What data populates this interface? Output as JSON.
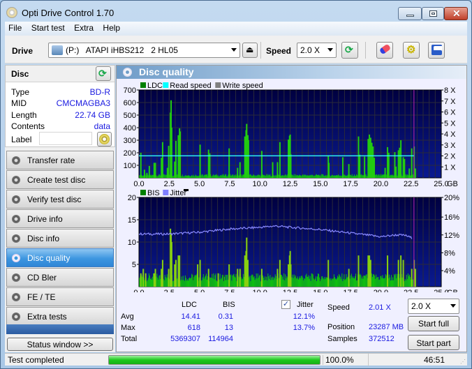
{
  "window": {
    "title": "Opti Drive Control 1.70"
  },
  "menu": [
    "File",
    "Start test",
    "Extra",
    "Help"
  ],
  "toolbar": {
    "drive_label": "Drive",
    "drive_value": "(P:)   ATAPI iHBS212   2 HL05",
    "speed_label": "Speed",
    "speed_value": "2.0 X"
  },
  "disc": {
    "title": "Disc",
    "fields": [
      {
        "key": "Type",
        "value": "BD-R"
      },
      {
        "key": "MID",
        "value": "CMCMAGBA3"
      },
      {
        "key": "Length",
        "value": "22.74 GB"
      },
      {
        "key": "Contents",
        "value": "data"
      }
    ],
    "label_key": "Label",
    "label_value": ""
  },
  "nav": [
    {
      "label": "Transfer rate",
      "active": false
    },
    {
      "label": "Create test disc",
      "active": false
    },
    {
      "label": "Verify test disc",
      "active": false
    },
    {
      "label": "Drive info",
      "active": false
    },
    {
      "label": "Disc info",
      "active": false
    },
    {
      "label": "Disc quality",
      "active": true
    },
    {
      "label": "CD Bler",
      "active": false
    },
    {
      "label": "FE / TE",
      "active": false
    },
    {
      "label": "Extra tests",
      "active": false
    }
  ],
  "status_window_label": "Status window >>",
  "panel_title": "Disc quality",
  "chart_data": [
    {
      "type": "bar",
      "title": "LDC",
      "legend": [
        {
          "name": "LDC",
          "color": "#008000"
        },
        {
          "name": "Read speed",
          "color": "#00ffff"
        },
        {
          "name": "Write speed",
          "color": "#808080"
        }
      ],
      "xlabel": "GB",
      "xlim": [
        0,
        25
      ],
      "x_ticks": [
        "0.0",
        "2.5",
        "5.0",
        "7.5",
        "10.0",
        "12.5",
        "15.0",
        "17.5",
        "20.0",
        "22.5",
        "25.0"
      ],
      "ylim": [
        0,
        700
      ],
      "y_ticks": [
        "100",
        "200",
        "300",
        "400",
        "500",
        "600",
        "700"
      ],
      "y2_ticks": [
        "1 X",
        "2 X",
        "3 X",
        "4 X",
        "5 X",
        "6 X",
        "7 X",
        "8 X"
      ],
      "y2lim": [
        0,
        8
      ],
      "baseline": 20,
      "peaks": [
        [
          0.1,
          200
        ],
        [
          0.4,
          65
        ],
        [
          0.6,
          40
        ],
        [
          0.8,
          95
        ],
        [
          1.2,
          120
        ],
        [
          1.3,
          120
        ],
        [
          1.8,
          160
        ],
        [
          1.9,
          285
        ],
        [
          2.3,
          80
        ],
        [
          2.4,
          255
        ],
        [
          2.55,
          520
        ],
        [
          2.6,
          618
        ],
        [
          2.65,
          400
        ],
        [
          2.9,
          130
        ],
        [
          3.0,
          295
        ],
        [
          3.2,
          340
        ],
        [
          3.3,
          395
        ],
        [
          3.35,
          370
        ],
        [
          5.0,
          265
        ],
        [
          5.7,
          225
        ],
        [
          5.8,
          195
        ],
        [
          7.4,
          235
        ],
        [
          8.1,
          80
        ],
        [
          8.3,
          125
        ],
        [
          8.7,
          330
        ],
        [
          8.8,
          380
        ],
        [
          8.85,
          430
        ],
        [
          8.95,
          340
        ],
        [
          9.0,
          300
        ],
        [
          10.1,
          215
        ],
        [
          11.0,
          125
        ],
        [
          11.4,
          125
        ],
        [
          11.6,
          285
        ],
        [
          12.3,
          305
        ],
        [
          12.4,
          335
        ],
        [
          12.45,
          345
        ],
        [
          12.5,
          190
        ],
        [
          15.6,
          180
        ],
        [
          15.65,
          120
        ],
        [
          16.8,
          165
        ],
        [
          17.3,
          110
        ],
        [
          18.1,
          330
        ],
        [
          18.2,
          185
        ],
        [
          18.6,
          170
        ],
        [
          18.9,
          310
        ],
        [
          19.0,
          345
        ],
        [
          19.1,
          320
        ],
        [
          19.2,
          280
        ],
        [
          19.3,
          250
        ],
        [
          19.4,
          160
        ],
        [
          20.3,
          80
        ],
        [
          20.5,
          245
        ],
        [
          20.6,
          200
        ],
        [
          21.1,
          205
        ],
        [
          21.2,
          90
        ],
        [
          21.4,
          220
        ],
        [
          21.5,
          240
        ],
        [
          21.6,
          300
        ],
        [
          21.8,
          165
        ],
        [
          21.9,
          150
        ],
        [
          22.3,
          75
        ],
        [
          22.5,
          235
        ],
        [
          22.7,
          250
        ],
        [
          22.8,
          75
        ]
      ],
      "read_speed_x": 2.01,
      "read_speed_range": [
        0,
        22.74
      ],
      "end_marker": 22.74
    },
    {
      "type": "bar",
      "title": "BIS / Jitter",
      "legend": [
        {
          "name": "BIS",
          "color": "#008000"
        },
        {
          "name": "Jitter",
          "color": "#8080ff"
        }
      ],
      "xlabel": "GB",
      "xlim": [
        0,
        25
      ],
      "x_ticks": [
        "0.0",
        "2.5",
        "5.0",
        "7.5",
        "10.0",
        "12.5",
        "15.0",
        "17.5",
        "20.0",
        "22.5",
        "25.0"
      ],
      "ylim": [
        0,
        20
      ],
      "y_ticks": [
        "5",
        "10",
        "15",
        "20"
      ],
      "y2lim": [
        0,
        20
      ],
      "y2_ticks": [
        "4%",
        "8%",
        "12%",
        "16%",
        "20%"
      ],
      "baseline": 2,
      "peaks": [
        [
          0.1,
          3
        ],
        [
          0.3,
          4
        ],
        [
          0.5,
          3
        ],
        [
          1.2,
          3
        ],
        [
          1.3,
          4
        ],
        [
          1.8,
          4
        ],
        [
          1.9,
          6
        ],
        [
          2.4,
          4
        ],
        [
          2.55,
          13
        ],
        [
          2.6,
          12
        ],
        [
          2.65,
          10
        ],
        [
          2.9,
          5
        ],
        [
          3.0,
          6
        ],
        [
          3.2,
          7
        ],
        [
          3.3,
          7
        ],
        [
          4.8,
          5
        ],
        [
          5.0,
          6
        ],
        [
          5.7,
          4
        ],
        [
          6.5,
          3
        ],
        [
          7.4,
          5
        ],
        [
          8.1,
          4
        ],
        [
          8.3,
          4
        ],
        [
          8.7,
          7
        ],
        [
          8.8,
          8
        ],
        [
          8.85,
          11
        ],
        [
          8.95,
          6
        ],
        [
          10.1,
          4
        ],
        [
          11.4,
          4
        ],
        [
          11.6,
          6
        ],
        [
          12.3,
          5
        ],
        [
          12.4,
          7
        ],
        [
          12.45,
          8
        ],
        [
          12.5,
          5
        ],
        [
          15.6,
          6
        ],
        [
          17.3,
          4
        ],
        [
          18.1,
          7
        ],
        [
          18.9,
          7
        ],
        [
          19.0,
          7
        ],
        [
          19.1,
          6
        ],
        [
          20.5,
          7
        ],
        [
          21.4,
          6
        ],
        [
          21.6,
          7
        ],
        [
          21.8,
          6
        ],
        [
          22.5,
          4
        ],
        [
          22.7,
          6
        ],
        [
          22.8,
          4
        ]
      ],
      "jitter": [
        [
          0,
          11.8
        ],
        [
          2.5,
          11.8
        ],
        [
          5.0,
          12.2
        ],
        [
          7.5,
          12.9
        ],
        [
          10.0,
          13.3
        ],
        [
          11.3,
          13.6
        ],
        [
          12.5,
          13.3
        ],
        [
          15.0,
          12.8
        ],
        [
          17.5,
          12.0
        ],
        [
          20.0,
          11.2
        ],
        [
          21.3,
          11.6
        ],
        [
          22.0,
          11.5
        ],
        [
          22.6,
          10.9
        ]
      ],
      "end_marker": 22.74
    }
  ],
  "stats": {
    "col_ldc": "LDC",
    "col_bis": "BIS",
    "jitter_label": "Jitter",
    "jitter_checked": true,
    "rows": [
      {
        "label": "Avg",
        "ldc": "14.41",
        "bis": "0.31",
        "jitter": "12.1%"
      },
      {
        "label": "Max",
        "ldc": "618",
        "bis": "13",
        "jitter": "13.7%"
      },
      {
        "label": "Total",
        "ldc": "5369307",
        "bis": "114964",
        "jitter": ""
      }
    ],
    "speed_label": "Speed",
    "speed_value": "2.01 X",
    "position_label": "Position",
    "position_value": "23287 MB",
    "samples_label": "Samples",
    "samples_value": "372512",
    "speed_select": "2.0 X",
    "start_full": "Start full",
    "start_part": "Start part"
  },
  "status": {
    "text": "Test completed",
    "progress": 100.0,
    "progress_text": "100.0%",
    "time": "46:51"
  }
}
